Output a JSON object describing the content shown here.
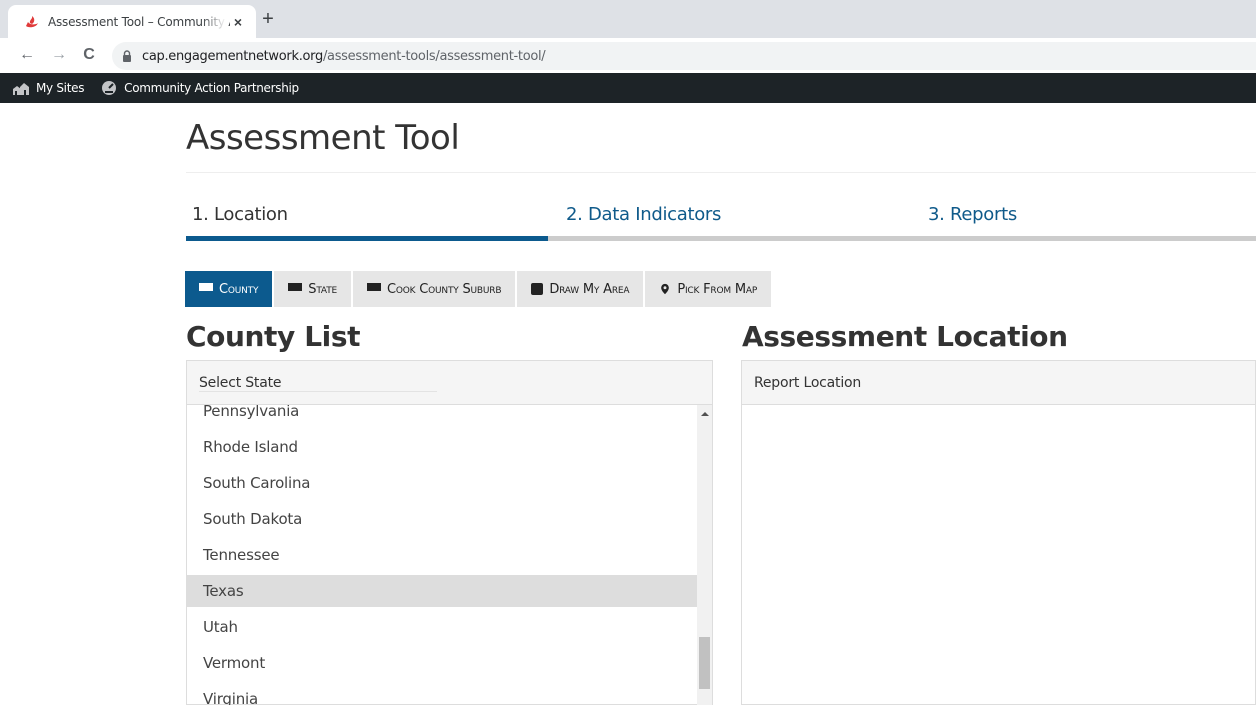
{
  "browser": {
    "tab_title": "Assessment Tool – Community Action",
    "tab_close": "×",
    "new_tab": "+",
    "url_host": "cap.engagementnetwork.org",
    "url_path": "/assessment-tools/assessment-tool/",
    "back": "←",
    "forward": "→",
    "reload": "C"
  },
  "admin_bar": {
    "my_sites": "My Sites",
    "site_name": "Community Action Partnership"
  },
  "page": {
    "title": "Assessment Tool"
  },
  "steps": [
    {
      "label": "1. Location"
    },
    {
      "label": "2. Data Indicators"
    },
    {
      "label": "3. Reports"
    }
  ],
  "step_progress": 0.338,
  "location_buttons": [
    {
      "label": "County",
      "icon": "list-icon",
      "active": true
    },
    {
      "label": "State",
      "icon": "list-icon",
      "active": false
    },
    {
      "label": "Cook County Suburb",
      "icon": "list-icon",
      "active": false
    },
    {
      "label": "Draw My Area",
      "icon": "square-icon",
      "active": false
    },
    {
      "label": "Pick From Map",
      "icon": "map-marker-icon",
      "active": false
    }
  ],
  "county_list": {
    "heading": "County List",
    "header_label": "Select State",
    "items": [
      "Pennsylvania",
      "Rhode Island",
      "South Carolina",
      "South Dakota",
      "Tennessee",
      "Texas",
      "Utah",
      "Vermont",
      "Virginia"
    ],
    "selected": "Texas"
  },
  "assessment_location": {
    "heading": "Assessment Location",
    "header_label": "Report Location"
  },
  "colors": {
    "accent": "#0c5a8e",
    "admin_bar": "#1d2327",
    "selected_row": "#dddddd"
  }
}
